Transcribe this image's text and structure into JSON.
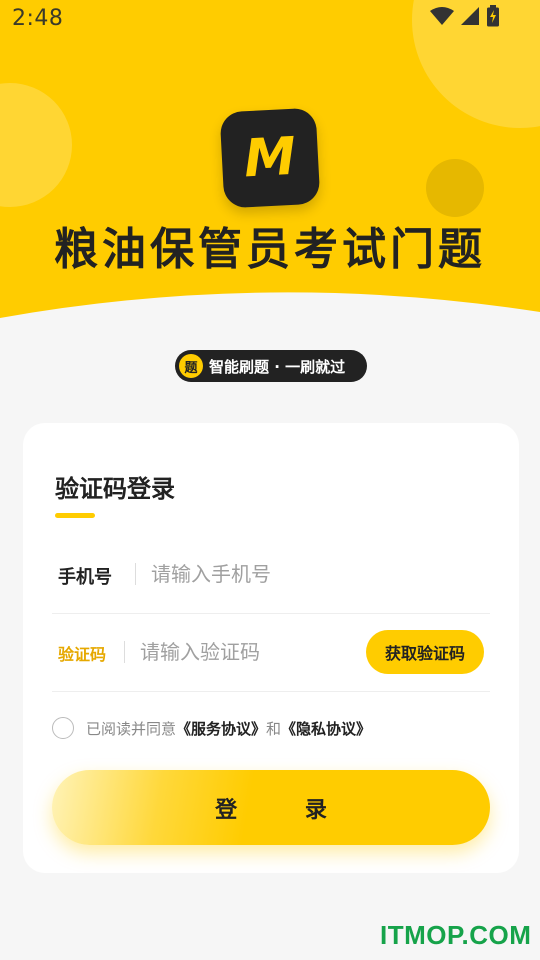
{
  "status_bar": {
    "time": "2:48",
    "icons": [
      "wifi-icon",
      "cellular-signal-icon",
      "battery-charging-icon"
    ]
  },
  "app": {
    "logo_letter": "M",
    "title": "粮油保管员考试门题",
    "slogan_badge": "题",
    "slogan": "智能刷题 · 一刷就过"
  },
  "login_card": {
    "title": "验证码登录",
    "phone_label": "手机号",
    "phone_placeholder": "请输入手机号",
    "phone_value": "",
    "code_label": "验证码",
    "code_placeholder": "请输入验证码",
    "code_value": "",
    "get_code_button": "获取验证码",
    "agreement_prefix": "已阅读并同意",
    "service_agreement": "《服务协议》",
    "agreement_and": "和",
    "privacy_agreement": "《隐私协议》",
    "agreement_checked": false,
    "login_button": "登 录"
  },
  "watermark": "ITMOP.COM",
  "colors": {
    "accent": "#ffcc00",
    "accent_dark": "#e6b800",
    "dark": "#222222",
    "background": "#f6f6f6",
    "code_label": "#e6a800",
    "watermark": "#16a34a"
  }
}
